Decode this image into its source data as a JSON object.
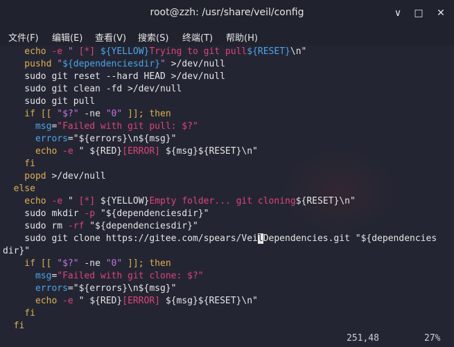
{
  "window": {
    "title": "root@zzh: /usr/share/veil/config",
    "controls": {
      "minimize": "∨",
      "maximize": "□",
      "close": "✕"
    }
  },
  "menubar": {
    "items": [
      {
        "label": "文件(F)"
      },
      {
        "label": "编辑(E)"
      },
      {
        "label": "查看(V)"
      },
      {
        "label": "搜索(S)"
      },
      {
        "label": "终端(T)"
      },
      {
        "label": "帮助(H)"
      }
    ]
  },
  "terminal": {
    "lines": [
      [
        {
          "t": "    echo ",
          "c": "k"
        },
        {
          "t": "-e ",
          "c": "r"
        },
        {
          "t": "\" ",
          "c": "p"
        },
        {
          "t": "[*] ",
          "c": "r"
        },
        {
          "t": "${YELLOW}",
          "c": "b"
        },
        {
          "t": "Trying to git pull",
          "c": "r"
        },
        {
          "t": "${RESET}",
          "c": "b"
        },
        {
          "t": "\\n\"",
          "c": "w"
        }
      ],
      [
        {
          "t": "    pushd ",
          "c": "k"
        },
        {
          "t": "\"",
          "c": "p"
        },
        {
          "t": "${dependenciesdir}",
          "c": "b"
        },
        {
          "t": "\" ",
          "c": "p"
        },
        {
          "t": ">/dev/null",
          "c": "w"
        }
      ],
      [
        {
          "t": "    sudo git reset --hard HEAD ",
          "c": "w"
        },
        {
          "t": ">/dev/null",
          "c": "w"
        }
      ],
      [
        {
          "t": "    sudo git clean -fd ",
          "c": "w"
        },
        {
          "t": ">/dev/null",
          "c": "w"
        }
      ],
      [
        {
          "t": "    sudo git pull",
          "c": "w"
        }
      ],
      [
        {
          "t": "    if ",
          "c": "k"
        },
        {
          "t": "[[ ",
          "c": "k"
        },
        {
          "t": "\"$?\" ",
          "c": "p"
        },
        {
          "t": "-ne ",
          "c": "w"
        },
        {
          "t": "\"0\" ",
          "c": "p"
        },
        {
          "t": "]]; then",
          "c": "k"
        }
      ],
      [
        {
          "t": "      msg",
          "c": "b"
        },
        {
          "t": "=",
          "c": "w"
        },
        {
          "t": "\"Failed with git pull: $?\"",
          "c": "r"
        }
      ],
      [
        {
          "t": "      errors",
          "c": "b"
        },
        {
          "t": "=",
          "c": "w"
        },
        {
          "t": "\"${errors}\\n${msg}\"",
          "c": "w"
        }
      ],
      [
        {
          "t": "      echo ",
          "c": "k"
        },
        {
          "t": "-e ",
          "c": "r"
        },
        {
          "t": "\" ",
          "c": "w"
        },
        {
          "t": "${RED}",
          "c": "w"
        },
        {
          "t": "[ERROR] ",
          "c": "r"
        },
        {
          "t": "${msg}${RESET}",
          "c": "w"
        },
        {
          "t": "\\n\"",
          "c": "w"
        }
      ],
      [
        {
          "t": "    fi",
          "c": "k"
        }
      ],
      [
        {
          "t": "    popd ",
          "c": "k"
        },
        {
          "t": ">/dev/null",
          "c": "w"
        }
      ],
      [
        {
          "t": "  else",
          "c": "k"
        }
      ],
      [
        {
          "t": "    echo ",
          "c": "k"
        },
        {
          "t": "-e ",
          "c": "r"
        },
        {
          "t": "\" ",
          "c": "w"
        },
        {
          "t": "[*] ",
          "c": "r"
        },
        {
          "t": "${YELLOW}",
          "c": "w"
        },
        {
          "t": "Empty folder... git cloning",
          "c": "r"
        },
        {
          "t": "${RESET}",
          "c": "w"
        },
        {
          "t": "\\n\"",
          "c": "w"
        }
      ],
      [
        {
          "t": "    sudo mkdir ",
          "c": "w"
        },
        {
          "t": "-p ",
          "c": "r"
        },
        {
          "t": "\"${dependenciesdir}\"",
          "c": "w"
        }
      ],
      [
        {
          "t": "    sudo rm ",
          "c": "w"
        },
        {
          "t": "-rf ",
          "c": "r"
        },
        {
          "t": "\"${dependenciesdir}\"",
          "c": "w"
        }
      ],
      [
        {
          "t": "    sudo git clone https://gitee.com/spears/Vei",
          "c": "w"
        },
        {
          "t": "l",
          "c": "cursor"
        },
        {
          "t": "Dependencies.git ",
          "c": "w"
        },
        {
          "t": "\"${dependencies",
          "c": "w"
        }
      ],
      [
        {
          "t": "dir}\"",
          "c": "w"
        }
      ],
      [
        {
          "t": "    if ",
          "c": "k"
        },
        {
          "t": "[[ ",
          "c": "k"
        },
        {
          "t": "\"$?\" ",
          "c": "p"
        },
        {
          "t": "-ne ",
          "c": "w"
        },
        {
          "t": "\"0\" ",
          "c": "p"
        },
        {
          "t": "]]; then",
          "c": "k"
        }
      ],
      [
        {
          "t": "      msg",
          "c": "b"
        },
        {
          "t": "=",
          "c": "w"
        },
        {
          "t": "\"Failed with git clone: $?\"",
          "c": "r"
        }
      ],
      [
        {
          "t": "      errors",
          "c": "b"
        },
        {
          "t": "=",
          "c": "w"
        },
        {
          "t": "\"${errors}\\n${msg}\"",
          "c": "w"
        }
      ],
      [
        {
          "t": "      echo ",
          "c": "k"
        },
        {
          "t": "-e ",
          "c": "r"
        },
        {
          "t": "\" ",
          "c": "w"
        },
        {
          "t": "${RED}",
          "c": "w"
        },
        {
          "t": "[ERROR] ",
          "c": "r"
        },
        {
          "t": "${msg}${RESET}",
          "c": "w"
        },
        {
          "t": "\\n\"",
          "c": "w"
        }
      ],
      [
        {
          "t": "    fi",
          "c": "k"
        }
      ],
      [
        {
          "t": "  fi",
          "c": "k"
        }
      ]
    ],
    "status": {
      "position": "251,48",
      "percent": "27%"
    }
  }
}
